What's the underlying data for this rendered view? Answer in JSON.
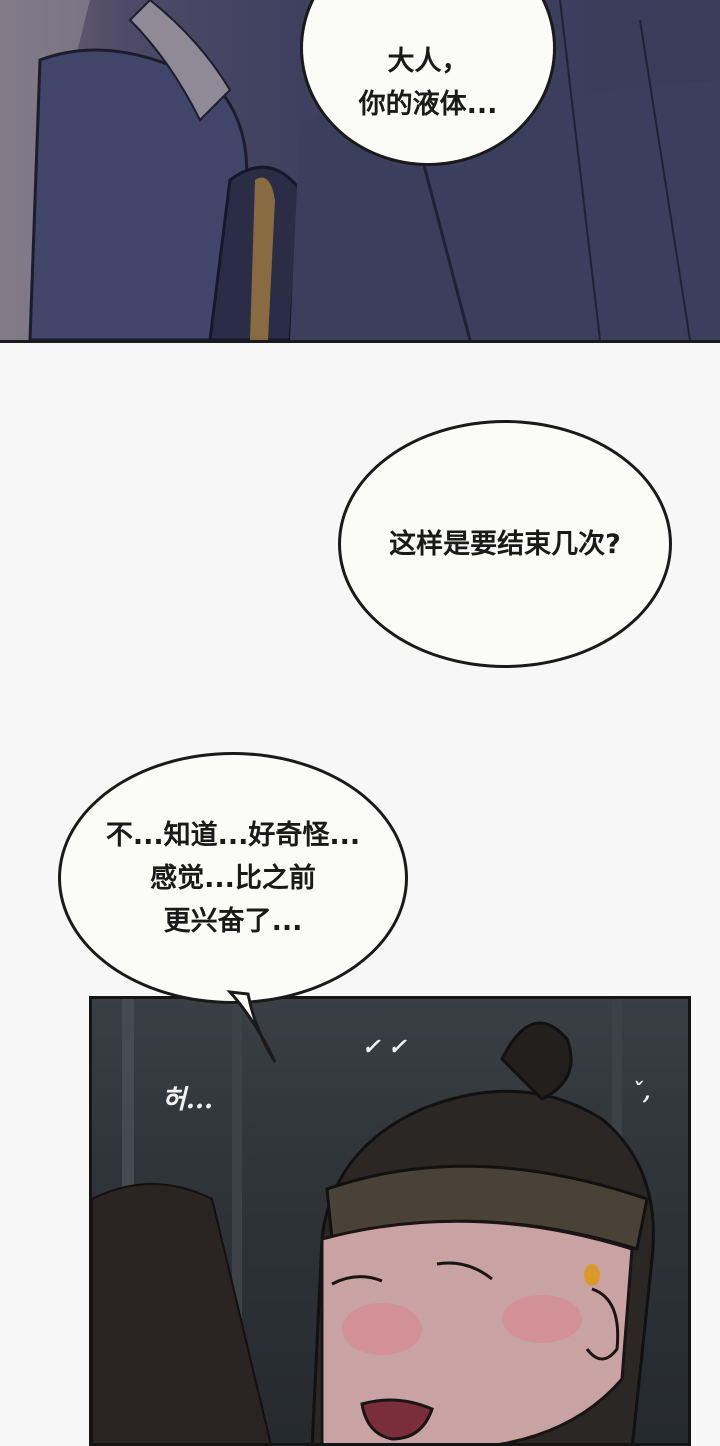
{
  "bubbles": {
    "top": {
      "lines": [
        "大人，",
        "你的液体..."
      ]
    },
    "middle": {
      "lines": [
        "这样是要结束几次?"
      ]
    },
    "lower": {
      "lines": [
        "不...知道...好奇怪...",
        "感觉...比之前",
        "更兴奋了..."
      ]
    }
  },
  "sfx": {
    "breath": "허..."
  },
  "colors": {
    "page_bg": "#f7f7f7",
    "top_panel": "#3c3f5e",
    "bottom_panel": "#2f3438",
    "ink": "#1a1a1a",
    "skin": "#c9a2a4",
    "blush": "#d9868f"
  }
}
